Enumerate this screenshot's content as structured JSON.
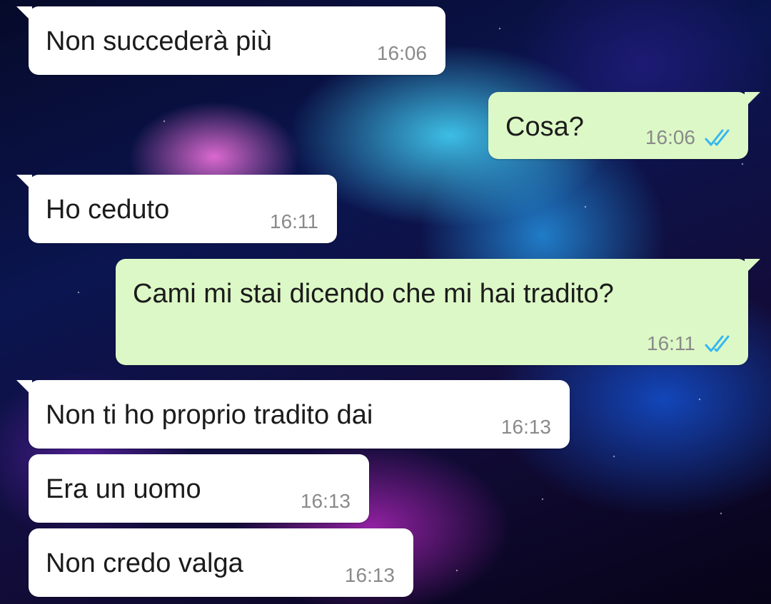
{
  "chat": {
    "messages": [
      {
        "direction": "incoming",
        "text": "Non succederà più",
        "time": "16:06"
      },
      {
        "direction": "outgoing",
        "text": "Cosa?",
        "time": "16:06",
        "status": "read"
      },
      {
        "direction": "incoming",
        "text": "Ho ceduto",
        "time": "16:11"
      },
      {
        "direction": "outgoing",
        "text": "Cami mi stai dicendo che mi hai tradito?",
        "time": "16:11",
        "status": "read"
      },
      {
        "direction": "incoming",
        "text": "Non ti ho proprio tradito dai",
        "time": "16:13"
      },
      {
        "direction": "incoming",
        "text": "Era un uomo",
        "time": "16:13"
      },
      {
        "direction": "incoming",
        "text": "Non credo valga",
        "time": "16:13"
      }
    ]
  },
  "colors": {
    "incoming_bubble": "#ffffff",
    "outgoing_bubble": "#dcf8c6",
    "read_ticks": "#34b7f1",
    "timestamp": "#8a8a8a"
  },
  "icons": {
    "read_receipt": "double-check-icon"
  }
}
